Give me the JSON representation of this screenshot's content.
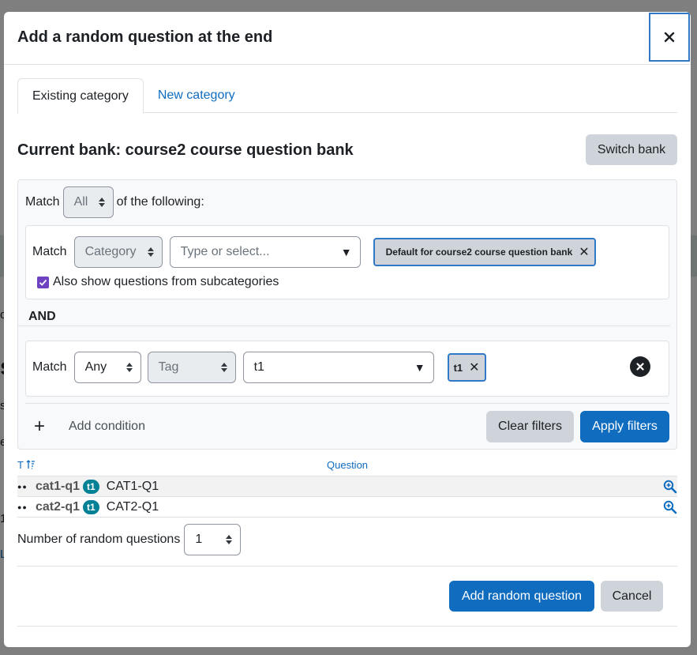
{
  "background": {
    "frag1": "o",
    "frag2": "s",
    "frag3": "s",
    "frag4": "e",
    "frag5": "1",
    "frag6": "L"
  },
  "modal": {
    "title": "Add a random question at the end",
    "close_icon": "close-icon"
  },
  "tabs": [
    {
      "label": "Existing category",
      "active": true
    },
    {
      "label": "New category",
      "active": false
    }
  ],
  "bank": {
    "title": "Current bank: course2 course question bank",
    "switch_label": "Switch bank"
  },
  "filters": {
    "match_label": "Match",
    "match_join": "All",
    "of_following": "of the following:",
    "condition1": {
      "match_label": "Match",
      "type": "Category",
      "combo_placeholder": "Type or select...",
      "chip": "Default for course2 course question bank",
      "subcat_label": "Also show questions from subcategories",
      "subcat_checked": true
    },
    "and_label": "AND",
    "condition2": {
      "match_label": "Match",
      "mode": "Any",
      "type": "Tag",
      "combo_value": "t1",
      "chip": "t1"
    },
    "add_condition_label": "Add condition",
    "clear_label": "Clear filters",
    "apply_label": "Apply filters"
  },
  "table": {
    "col_type": "T",
    "col_question": "Question",
    "rows": [
      {
        "name": "cat1-q1",
        "tag": "t1",
        "text": "CAT1-Q1"
      },
      {
        "name": "cat2-q1",
        "tag": "t1",
        "text": "CAT2-Q1"
      }
    ]
  },
  "random": {
    "label": "Number of random questions",
    "value": "1"
  },
  "actions": {
    "add_label": "Add random question",
    "cancel_label": "Cancel"
  },
  "colors": {
    "primary": "#0f6cbf",
    "badge": "#008196",
    "checkbox": "#6f42c1",
    "focus": "#3178c6"
  }
}
